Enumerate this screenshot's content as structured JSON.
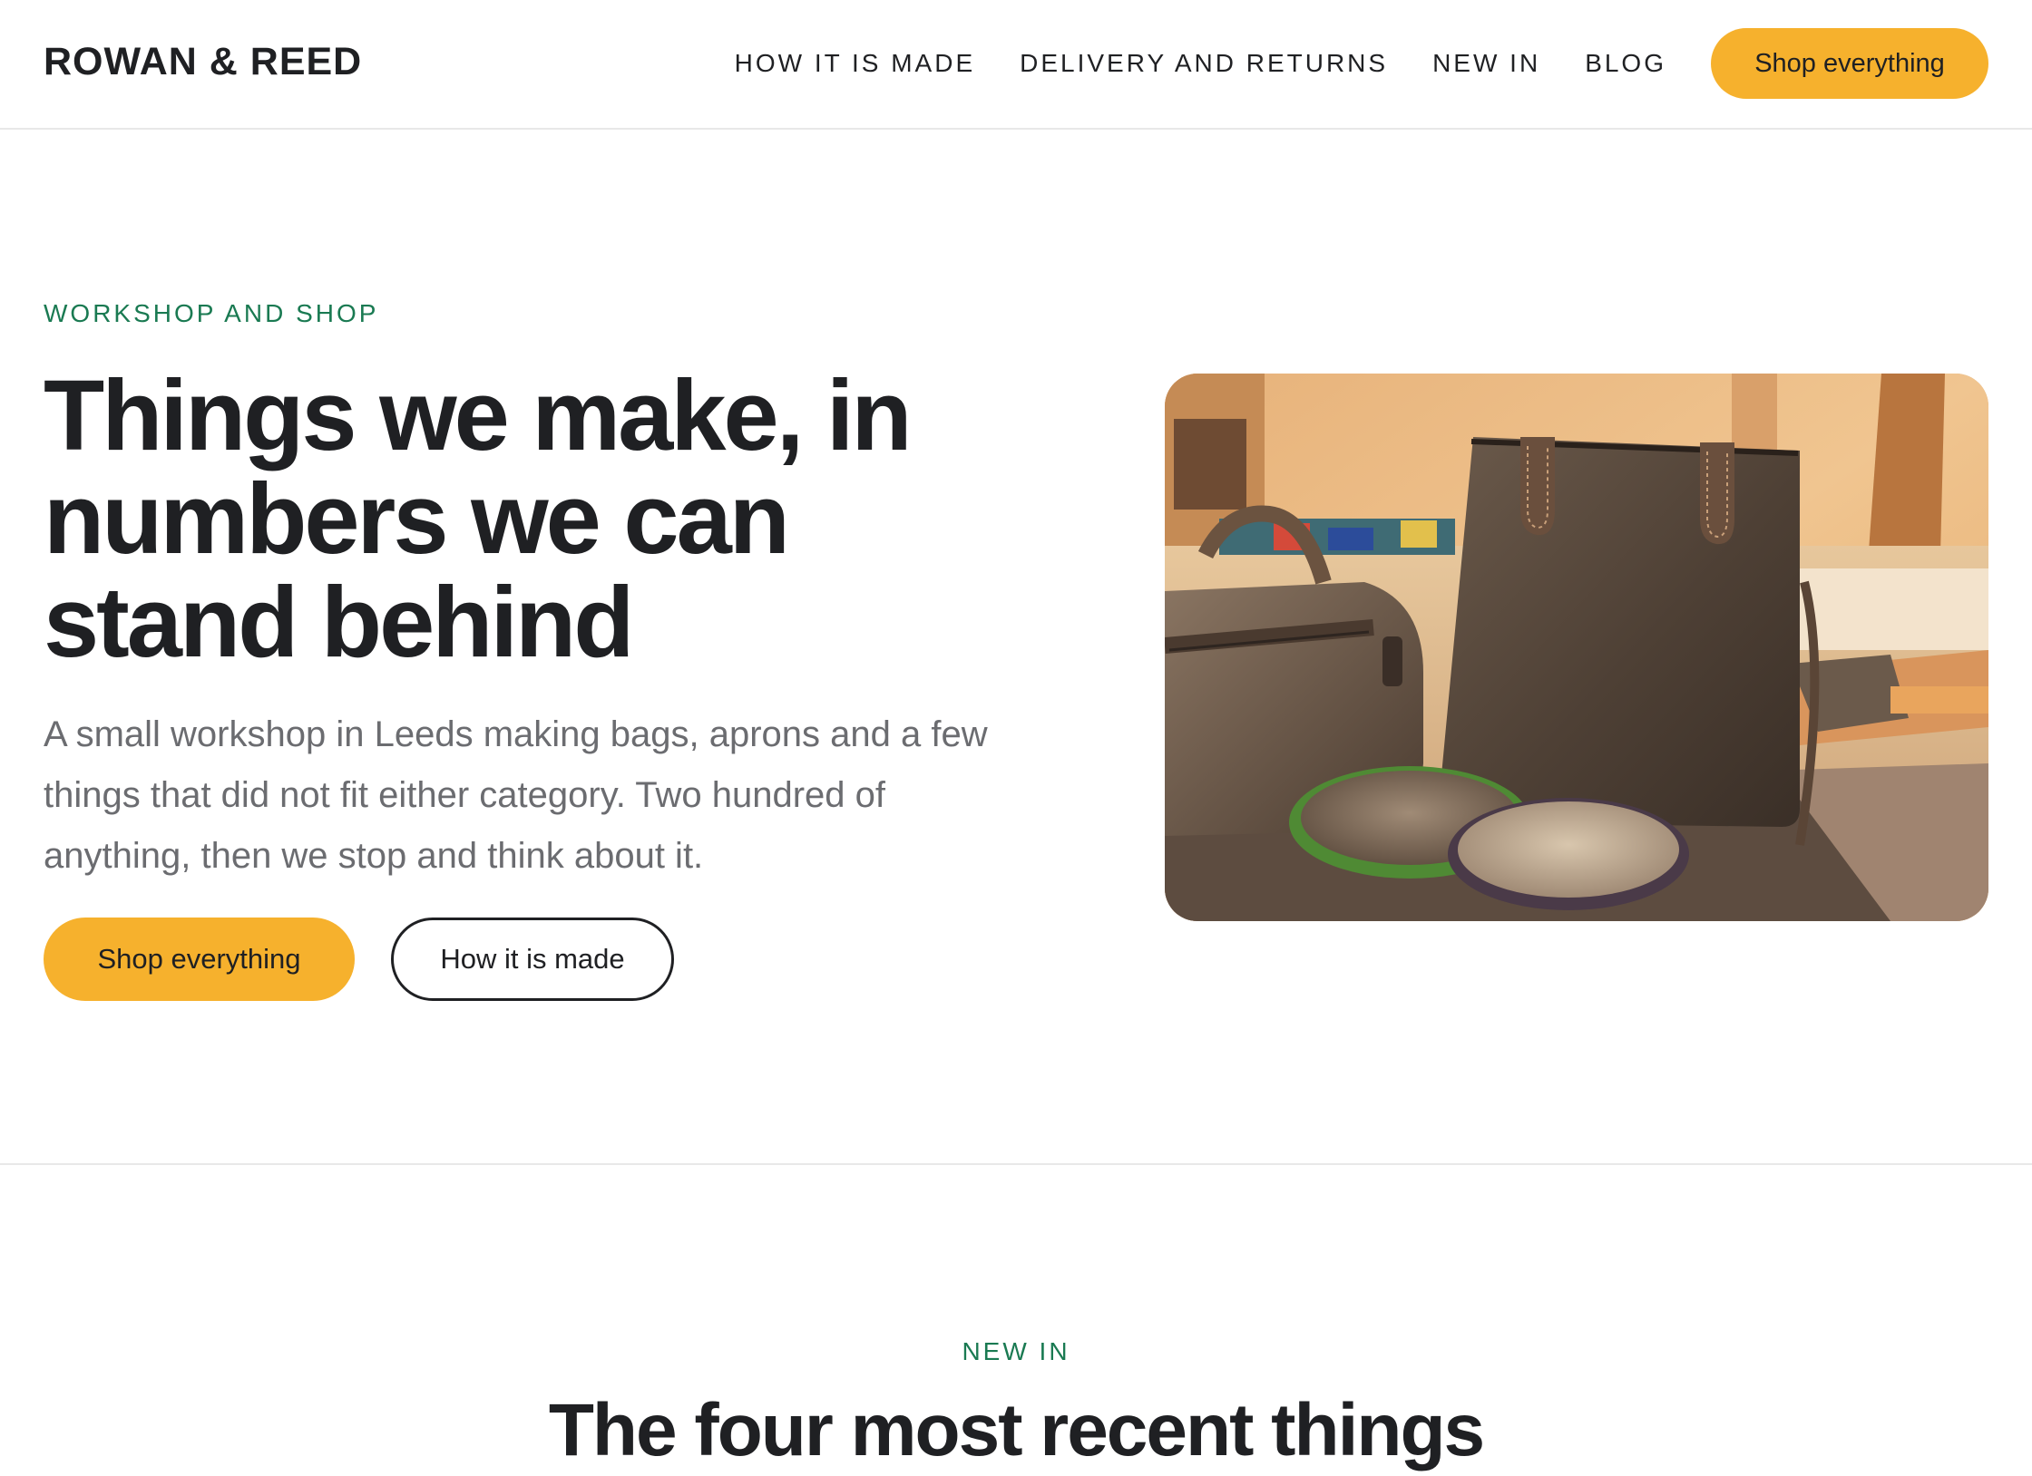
{
  "header": {
    "brand": "ROWAN & REED",
    "nav": [
      {
        "label": "HOW IT IS MADE"
      },
      {
        "label": "DELIVERY AND RETURNS"
      },
      {
        "label": "NEW IN"
      },
      {
        "label": "BLOG"
      }
    ],
    "cta_label": "Shop everything"
  },
  "hero": {
    "eyebrow": "WORKSHOP AND SHOP",
    "title": "Things we make, in numbers we can stand behind",
    "lead": "A small workshop in Leeds making bags, aprons and a few things that did not fit either category. Two hundred of anything, then we stop and think about it.",
    "primary_label": "Shop everything",
    "secondary_label": "How it is made",
    "image_alt": "Leather and hide bags with two small round trays on a workshop table"
  },
  "new_in": {
    "eyebrow": "NEW IN",
    "title": "The four most recent things"
  },
  "colors": {
    "accent": "#f6b12d",
    "eyebrow": "#1a7a52",
    "text": "#1f2023",
    "muted": "#6b6c70"
  }
}
